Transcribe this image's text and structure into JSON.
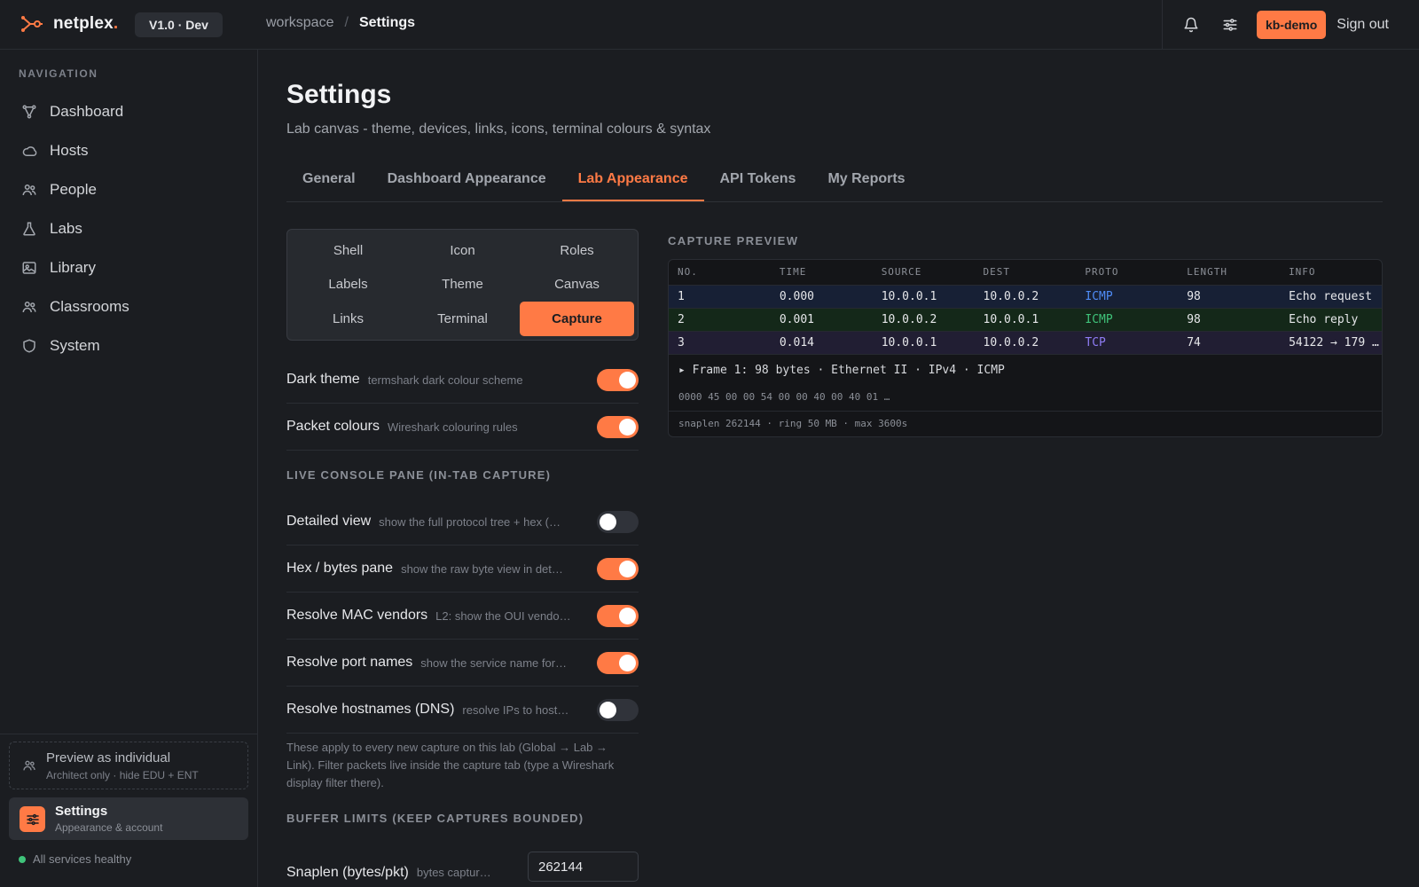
{
  "brand": {
    "name": "netplex",
    "dot": ".",
    "version": "V1.0 · Dev"
  },
  "breadcrumb": {
    "parent": "workspace",
    "separator": "/",
    "current": "Settings"
  },
  "topbar": {
    "user": "kb-demo",
    "sign_out": "Sign out"
  },
  "sidebar": {
    "heading": "NAVIGATION",
    "items": [
      {
        "label": "Dashboard",
        "icon": "graph-icon"
      },
      {
        "label": "Hosts",
        "icon": "cloud-icon"
      },
      {
        "label": "People",
        "icon": "people-icon"
      },
      {
        "label": "Labs",
        "icon": "flask-icon"
      },
      {
        "label": "Library",
        "icon": "image-icon"
      },
      {
        "label": "Classrooms",
        "icon": "people-icon"
      },
      {
        "label": "System",
        "icon": "shield-icon"
      }
    ],
    "preview": {
      "title": "Preview as individual",
      "subtitle": "Architect only · hide EDU + ENT"
    },
    "settings_card": {
      "title": "Settings",
      "subtitle": "Appearance & account"
    },
    "health": "All services healthy"
  },
  "page": {
    "title": "Settings",
    "subtitle": "Lab canvas - theme, devices, links, icons, terminal colours & syntax",
    "tabs": [
      "General",
      "Dashboard Appearance",
      "Lab Appearance",
      "API Tokens",
      "My Reports"
    ],
    "active_tab": "Lab Appearance"
  },
  "subtabs": [
    "Shell",
    "Icon",
    "Roles",
    "Labels",
    "Theme",
    "Canvas",
    "Links",
    "Terminal",
    "Capture"
  ],
  "active_subtab": "Capture",
  "settings": {
    "general": [
      {
        "label": "Dark theme",
        "hint": "termshark dark colour scheme",
        "on": true
      },
      {
        "label": "Packet colours",
        "hint": "Wireshark colouring rules",
        "on": true
      }
    ],
    "live_heading": "LIVE CONSOLE PANE (IN-TAB CAPTURE)",
    "live": [
      {
        "label": "Detailed view",
        "hint": "show the full protocol tree + hex (…",
        "on": false
      },
      {
        "label": "Hex / bytes pane",
        "hint": "show the raw byte view in det…",
        "on": true
      },
      {
        "label": "Resolve MAC vendors",
        "hint": "L2: show the OUI vendo…",
        "on": true
      },
      {
        "label": "Resolve port names",
        "hint": "show the service name for…",
        "on": true
      },
      {
        "label": "Resolve hostnames (DNS)",
        "hint": "resolve IPs to host…",
        "on": false
      }
    ],
    "note": "These apply to every new capture on this lab (Global → Lab → Link). Filter packets live inside the capture tab (type a Wireshark display filter there).",
    "buffer_heading": "BUFFER LIMITS (KEEP CAPTURES BOUNDED)",
    "snaplen": {
      "label": "Snaplen (bytes/pkt)",
      "hint": "bytes captur…",
      "value": "262144"
    }
  },
  "capture": {
    "heading": "CAPTURE PREVIEW",
    "columns": [
      "NO.",
      "TIME",
      "SOURCE",
      "DEST",
      "PROTO",
      "LENGTH",
      "INFO"
    ],
    "rows": [
      [
        "1",
        "0.000",
        "10.0.0.1",
        "10.0.0.2",
        "ICMP",
        "98",
        "Echo request"
      ],
      [
        "2",
        "0.001",
        "10.0.0.2",
        "10.0.0.1",
        "ICMP",
        "98",
        "Echo reply"
      ],
      [
        "3",
        "0.014",
        "10.0.0.1",
        "10.0.0.2",
        "TCP",
        "74",
        "54122 → 179 …"
      ]
    ],
    "proto_colors": [
      "#4f8cf7",
      "#3fc37a",
      "#8f7cf4"
    ],
    "frame": "▸ Frame 1: 98 bytes · Ethernet II · IPv4 · ICMP",
    "hex": "0000 45 00 00 54 00 00 40 00 40 01 …",
    "limits": "snaplen 262144 · ring 50 MB · max 3600s"
  },
  "colors": {
    "accent": "#ff7a45",
    "background": "#1b1d21",
    "healthy": "#3fc37a"
  }
}
